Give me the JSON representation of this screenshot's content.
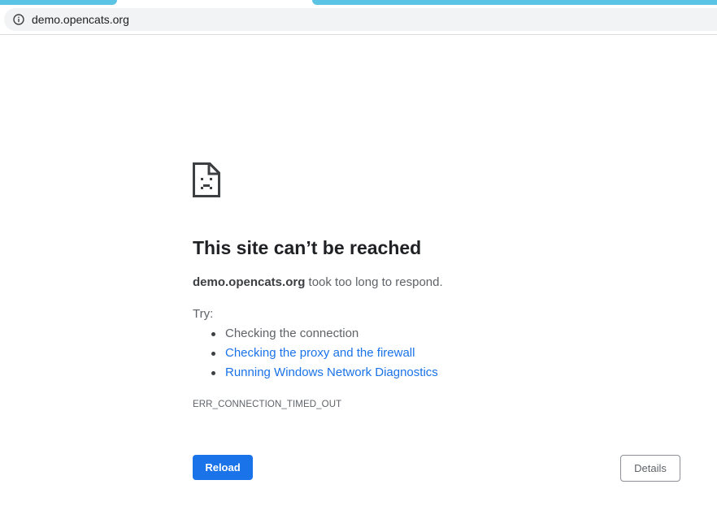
{
  "browser": {
    "url": "demo.opencats.org",
    "icons": {
      "site_info": "info-icon"
    },
    "colors": {
      "tab_accent": "#5bc3e3",
      "omnibox_bg": "#f1f3f4"
    }
  },
  "error_page": {
    "icon": "sad-page-icon",
    "title": "This site can’t be reached",
    "host": "demo.opencats.org",
    "message": " took too long to respond.",
    "try_label": "Try:",
    "suggestions": [
      {
        "text": "Checking the connection",
        "is_link": false
      },
      {
        "text": "Checking the proxy and the firewall",
        "is_link": true
      },
      {
        "text": "Running Windows Network Diagnostics",
        "is_link": true
      }
    ],
    "error_code": "ERR_CONNECTION_TIMED_OUT",
    "reload_label": "Reload",
    "details_label": "Details",
    "colors": {
      "primary": "#1a73e8",
      "link": "#1a73e8",
      "text": "#5f6368"
    }
  }
}
